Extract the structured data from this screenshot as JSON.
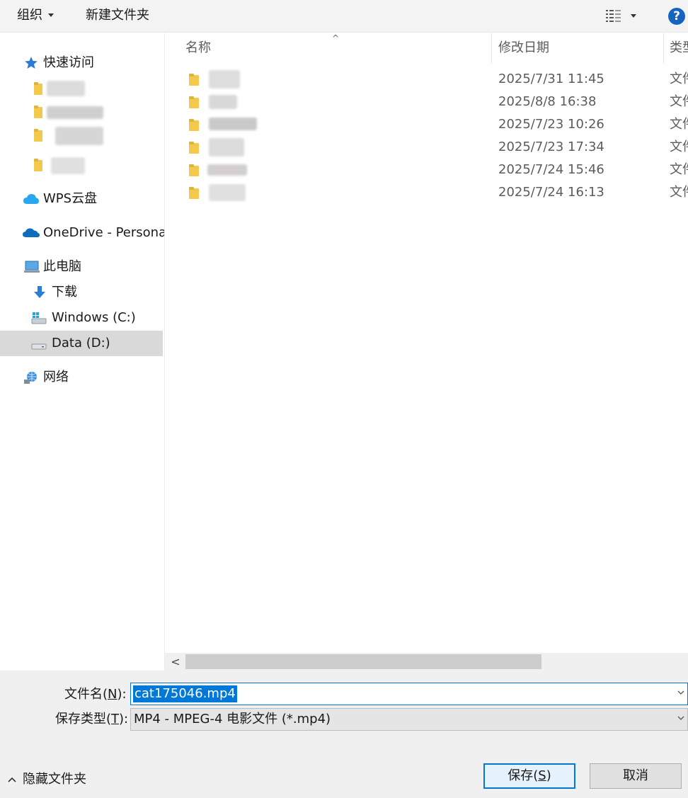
{
  "toolbar": {
    "organize": "组织",
    "new_folder": "新建文件夹",
    "help": "?"
  },
  "nav": {
    "quick_access": "快速访问",
    "wps_cloud": "WPS云盘",
    "onedrive": "OneDrive - Personal",
    "this_pc": "此电脑",
    "downloads": "下载",
    "windows_c": "Windows (C:)",
    "data_d": "Data (D:)",
    "network": "网络"
  },
  "columns": {
    "name": "名称",
    "modified": "修改日期",
    "type": "类型"
  },
  "files": [
    {
      "modified": "2025/7/31 11:45",
      "type": "文件"
    },
    {
      "modified": "2025/8/8 16:38",
      "type": "文件"
    },
    {
      "modified": "2025/7/23 10:26",
      "type": "文件"
    },
    {
      "modified": "2025/7/23 17:34",
      "type": "文件"
    },
    {
      "modified": "2025/7/24 15:46",
      "type": "文件"
    },
    {
      "modified": "2025/7/24 16:13",
      "type": "文件"
    }
  ],
  "form": {
    "filename_label": "文件名(N):",
    "filename_label_pre": "文件名(",
    "filename_label_key": "N",
    "filename_label_post": "):",
    "filename_value": "cat175046.mp4",
    "savetype_label_pre": "保存类型(",
    "savetype_label_key": "T",
    "savetype_label_post": "):",
    "savetype_value": "MP4 - MPEG-4 电影文件 (*.mp4)"
  },
  "footer": {
    "hide_folders": "隐藏文件夹",
    "save_pre": "保存(",
    "save_key": "S",
    "save_post": ")",
    "cancel": "取消"
  },
  "colors": {
    "accent": "#0078d7",
    "folder": "#f2c94c",
    "selected_nav": "#d9d9d9"
  }
}
